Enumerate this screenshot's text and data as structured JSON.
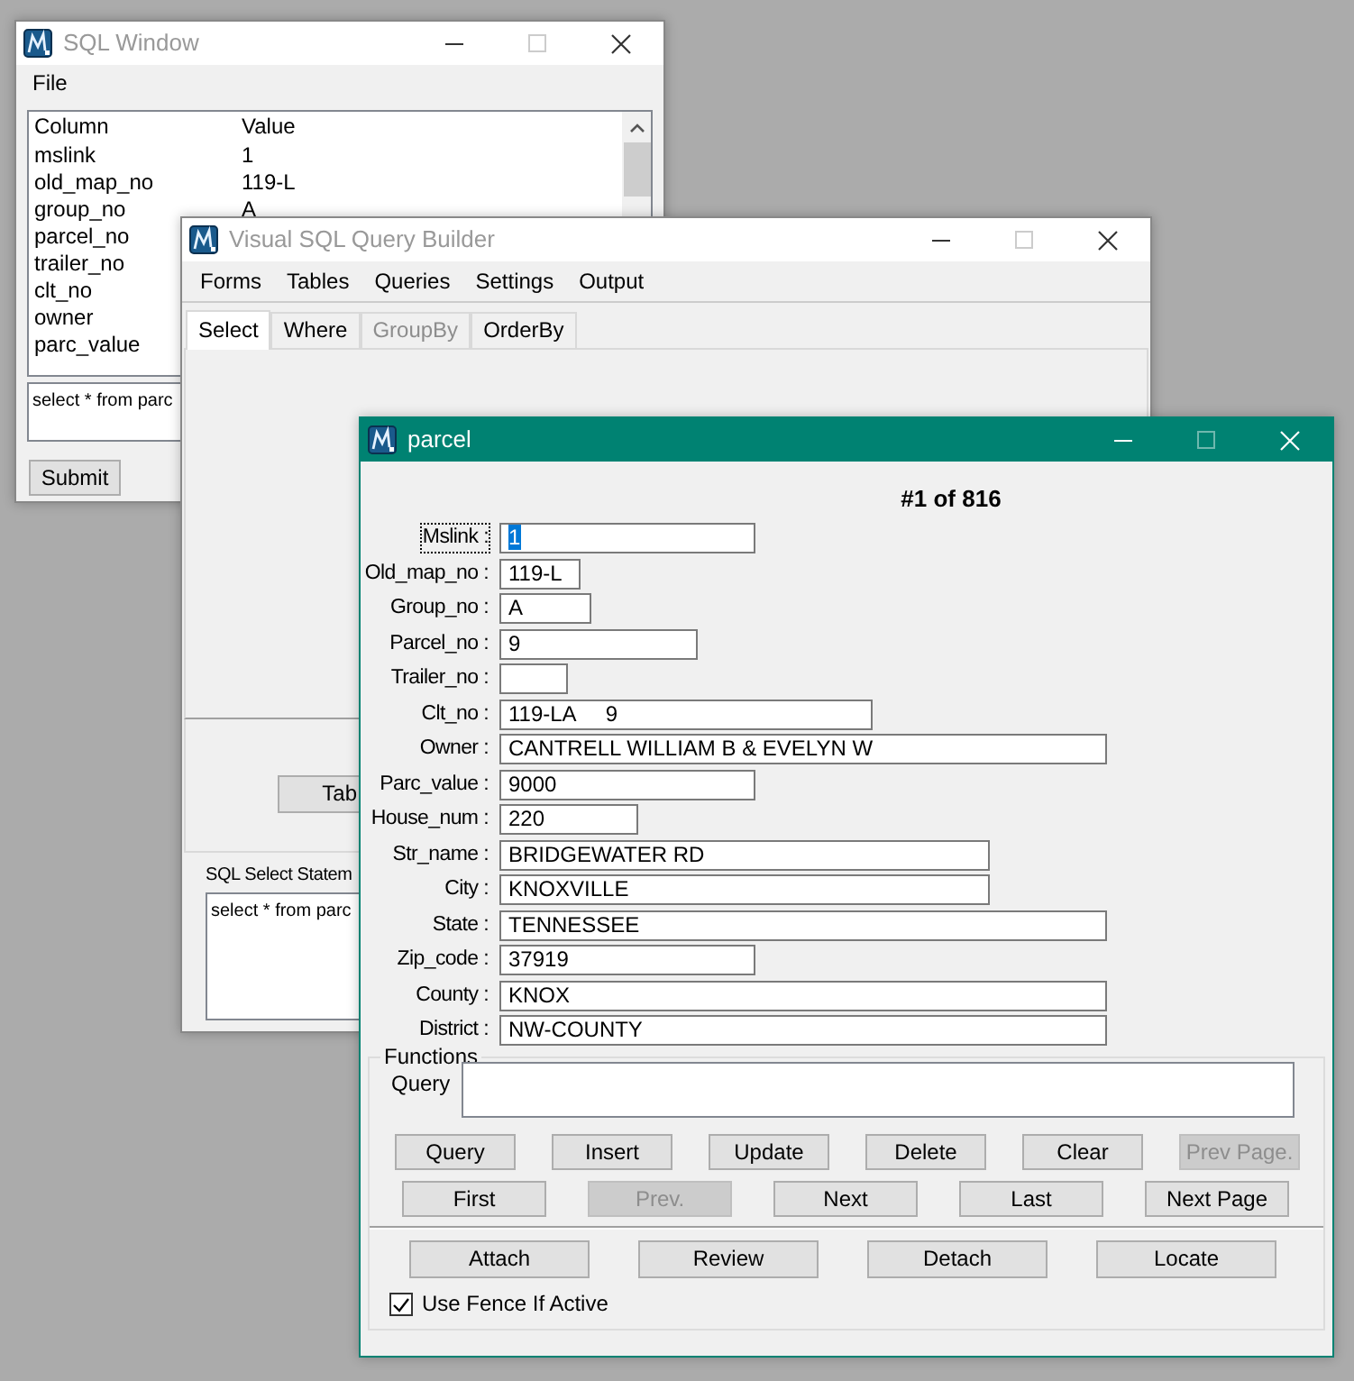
{
  "sql_window": {
    "title": "SQL Window",
    "menu": [
      "File"
    ],
    "list": {
      "columns": [
        "Column",
        "Value"
      ],
      "rows": [
        {
          "column": "mslink",
          "value": "1"
        },
        {
          "column": "old_map_no",
          "value": "119-L"
        },
        {
          "column": "group_no",
          "value": "A"
        },
        {
          "column": "parcel_no"
        },
        {
          "column": "trailer_no"
        },
        {
          "column": "clt_no"
        },
        {
          "column": "owner"
        },
        {
          "column": "parc_value"
        }
      ]
    },
    "statement": "select * from parc",
    "buttons": [
      "Submit"
    ]
  },
  "query_builder": {
    "title": "Visual SQL Query Builder",
    "menu": [
      "Forms",
      "Tables",
      "Queries",
      "Settings",
      "Output"
    ],
    "tabs": [
      {
        "label": "Select",
        "selected": true,
        "disabled": false
      },
      {
        "label": "Where",
        "selected": false,
        "disabled": false
      },
      {
        "label": "GroupBy",
        "selected": false,
        "disabled": true
      },
      {
        "label": "OrderBy",
        "selected": false,
        "disabled": false
      }
    ],
    "table_button": "Tab",
    "statement_label": "SQL Select Statem",
    "statement": "select * from parc"
  },
  "parcel_form": {
    "title": "parcel",
    "record": "#1 of 816",
    "fields": [
      {
        "label": "Mslink :",
        "value": "1",
        "focused": true
      },
      {
        "label": "Old_map_no :",
        "value": "119-L",
        "focused": false
      },
      {
        "label": "Group_no :",
        "value": "A",
        "focused": false
      },
      {
        "label": "Parcel_no :",
        "value": "9",
        "focused": false
      },
      {
        "label": "Trailer_no :",
        "focused": false
      },
      {
        "label": "Clt_no :",
        "value": "119-LA     9",
        "focused": false
      },
      {
        "label": "Owner :",
        "value": "CANTRELL WILLIAM B & EVELYN W",
        "focused": false
      },
      {
        "label": "Parc_value :",
        "value": "9000",
        "focused": false
      },
      {
        "label": "House_num :",
        "value": "220",
        "focused": false
      },
      {
        "label": "Str_name :",
        "value": "BRIDGEWATER RD",
        "focused": false
      },
      {
        "label": "City :",
        "value": "KNOXVILLE",
        "focused": false
      },
      {
        "label": "State :",
        "value": "TENNESSEE",
        "focused": false
      },
      {
        "label": "Zip_code :",
        "value": "37919",
        "focused": false
      },
      {
        "label": "County :",
        "value": "KNOX",
        "focused": false
      },
      {
        "label": "District :",
        "value": "NW-COUNTY",
        "focused": false
      }
    ],
    "functions": {
      "title": "Functions",
      "query_label": "Query",
      "button_rows": [
        [
          {
            "label": "Query",
            "disabled": false
          },
          {
            "label": "Insert",
            "disabled": false
          },
          {
            "label": "Update",
            "disabled": false
          },
          {
            "label": "Delete",
            "disabled": false
          },
          {
            "label": "Clear",
            "disabled": false
          },
          {
            "label": "Prev Page.",
            "disabled": true
          }
        ],
        [
          {
            "label": "First",
            "disabled": false
          },
          {
            "label": "Prev.",
            "disabled": true
          },
          {
            "label": "Next",
            "disabled": false
          },
          {
            "label": "Last",
            "disabled": false
          },
          {
            "label": "Next Page",
            "disabled": false
          }
        ]
      ],
      "actions": [
        {
          "label": "Attach",
          "disabled": false
        },
        {
          "label": "Review",
          "disabled": false
        },
        {
          "label": "Detach",
          "disabled": false
        },
        {
          "label": "Locate",
          "disabled": false
        }
      ],
      "fence": {
        "label": "Use Fence If Active",
        "checked": true
      }
    }
  }
}
